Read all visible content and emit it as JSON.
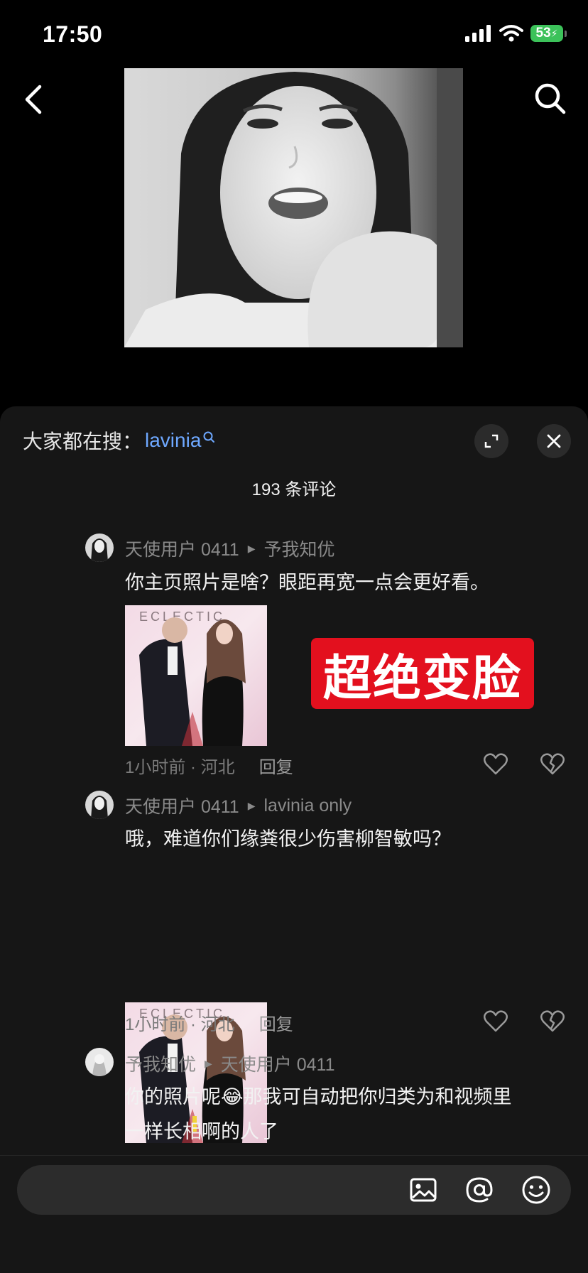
{
  "status_bar": {
    "time": "17:50",
    "battery": "53"
  },
  "trending": {
    "label": "大家都在搜：",
    "term": "lavinia"
  },
  "comment_count": "193 条评论",
  "comments": [
    {
      "user": "天使用户 0411",
      "reply_to": "予我知优",
      "text": "你主页照片是啥？眼距再宽一点会更好看。",
      "time_location": "1小时前 · 河北",
      "reply_label": "回复",
      "image_caption": "ECLECTIC"
    },
    {
      "user": "天使用户 0411",
      "reply_to": "lavinia only",
      "text": "哦，难道你们缘粪很少伤害柳智敏吗？",
      "time_location": "1小时前 · 河北",
      "reply_label": "回复",
      "image_caption": "ECLECTIC"
    },
    {
      "user": "予我知优",
      "reply_to": "天使用户 0411",
      "text_line1_a": "你的照片呢",
      "text_line1_b": "那我可自动把你归类为和视频里",
      "text_line2": "一样长相啊的人了",
      "emoji": "😂"
    }
  ],
  "overlay_banner": "超绝变脸",
  "input": {
    "placeholder": ""
  },
  "icons": {
    "back": "chevron-left-icon",
    "search": "search-icon",
    "expand": "expand-icon",
    "close": "close-icon",
    "like": "heart-icon",
    "dislike": "broken-heart-icon",
    "image": "image-icon",
    "mention": "at-icon",
    "emoji": "smiley-icon"
  },
  "colors": {
    "accent_link": "#6ea8ff",
    "banner_red": "#e3101e",
    "sheet_bg": "#161616",
    "battery_green": "#3cc25a"
  }
}
